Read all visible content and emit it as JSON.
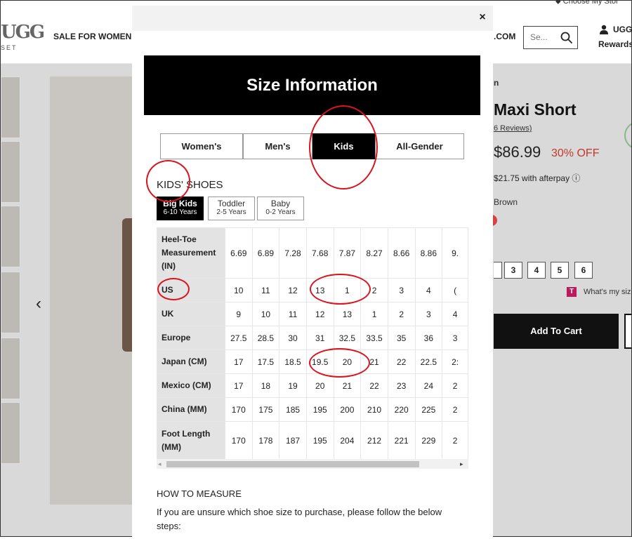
{
  "header": {
    "logo": "UGG",
    "logo_sub": "SET",
    "nav_sale": "SALE FOR WOMEN",
    "nav_com": ".COM",
    "search_placeholder": "Se...",
    "user_label": "UGG",
    "rewards_label": "Rewards",
    "store_label": "Choose My Stor"
  },
  "product": {
    "brand_suffix": "n",
    "title": "Maxi Short",
    "reviews": "6 Reviews)",
    "price": "$86.99",
    "discount": "30% OFF",
    "afterpay": "$21.75 with afterpay",
    "color": "Brown",
    "sizes": [
      "3",
      "4",
      "5",
      "6"
    ],
    "fit_link": "What's my siz",
    "add_to_cart": "Add To Cart"
  },
  "modal": {
    "close": "×",
    "banner": "Size Information",
    "tabs": [
      {
        "label": "Women's",
        "active": false
      },
      {
        "label": "Men's",
        "active": false
      },
      {
        "label": "Kids",
        "active": true
      },
      {
        "label": "All-Gender",
        "active": false
      }
    ],
    "section_title": "KIDS' SHOES",
    "age_tabs": [
      {
        "label": "Big Kids",
        "sub": "6-10 Years",
        "active": true
      },
      {
        "label": "Toddler",
        "sub": "2-5 Years",
        "active": false
      },
      {
        "label": "Baby",
        "sub": "0-2 Years",
        "active": false
      }
    ],
    "size_table": [
      {
        "label": "Heel-Toe Measurement (IN)",
        "values": [
          "6.69",
          "6.89",
          "7.28",
          "7.68",
          "7.87",
          "8.27",
          "8.66",
          "8.86",
          "9."
        ]
      },
      {
        "label": "US",
        "values": [
          "10",
          "11",
          "12",
          "13",
          "1",
          "2",
          "3",
          "4",
          "("
        ]
      },
      {
        "label": "UK",
        "values": [
          "9",
          "10",
          "11",
          "12",
          "13",
          "1",
          "2",
          "3",
          "4"
        ]
      },
      {
        "label": "Europe",
        "values": [
          "27.5",
          "28.5",
          "30",
          "31",
          "32.5",
          "33.5",
          "35",
          "36",
          "3"
        ]
      },
      {
        "label": "Japan (CM)",
        "values": [
          "17",
          "17.5",
          "18.5",
          "19.5",
          "20",
          "21",
          "22",
          "22.5",
          "2:"
        ]
      },
      {
        "label": "Mexico (CM)",
        "values": [
          "17",
          "18",
          "19",
          "20",
          "21",
          "22",
          "23",
          "24",
          "2"
        ]
      },
      {
        "label": "China (MM)",
        "values": [
          "170",
          "175",
          "185",
          "195",
          "200",
          "210",
          "220",
          "225",
          "2"
        ]
      },
      {
        "label": "Foot Length (MM)",
        "values": [
          "170",
          "178",
          "187",
          "195",
          "204",
          "212",
          "221",
          "229",
          "2"
        ]
      }
    ],
    "how_to_title": "HOW TO MEASURE",
    "how_to_text": "If you are unsure which shoe size to purchase, please follow the below steps:"
  }
}
